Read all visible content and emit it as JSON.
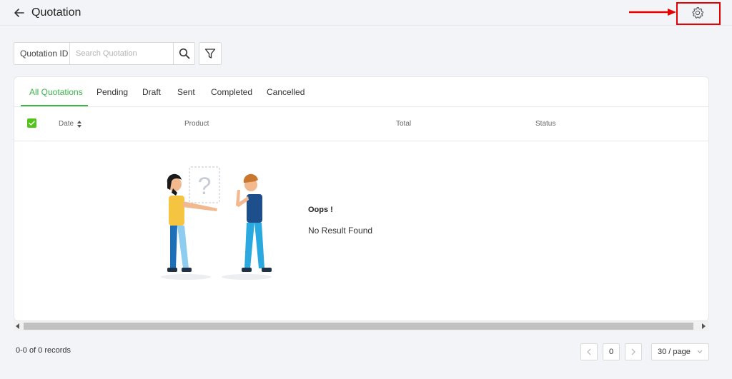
{
  "header": {
    "title": "Quotation"
  },
  "search": {
    "prefix_label": "Quotation ID",
    "placeholder": "Search Quotation",
    "value": ""
  },
  "tabs": [
    {
      "label": "All Quotations",
      "active": true
    },
    {
      "label": "Pending",
      "active": false
    },
    {
      "label": "Draft",
      "active": false
    },
    {
      "label": "Sent",
      "active": false
    },
    {
      "label": "Completed",
      "active": false
    },
    {
      "label": "Cancelled",
      "active": false
    }
  ],
  "table": {
    "columns": [
      "Date",
      "Product",
      "Total",
      "Status"
    ],
    "select_all_checked": true
  },
  "empty_state": {
    "title": "Oops !",
    "message": "No Result Found"
  },
  "footer": {
    "records": "0-0 of 0 records",
    "current_page": "0",
    "page_size": "30 / page"
  },
  "colors": {
    "accent": "#3bb54a",
    "checkbox": "#52c41a",
    "annotation": "#e60000"
  },
  "icons": [
    "back-arrow-icon",
    "gear-icon",
    "search-icon",
    "filter-icon",
    "sort-icon",
    "chevron-left-icon",
    "chevron-right-icon",
    "chevron-down-icon"
  ]
}
